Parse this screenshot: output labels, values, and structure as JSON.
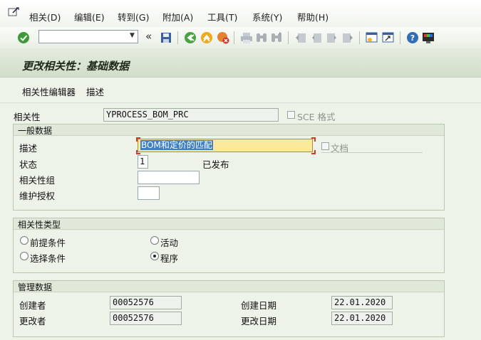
{
  "menu": {
    "items": [
      "相关(D)",
      "编辑(E)",
      "转到(G)",
      "附加(A)",
      "工具(T)",
      "系统(Y)",
      "帮助(H)"
    ]
  },
  "toolbar": {
    "command_field_value": "",
    "icons": [
      "enter-icon",
      "save-icon",
      "back-icon",
      "exit-icon",
      "cancel-icon",
      "print-icon",
      "find-icon",
      "find-next-icon",
      "first-page-icon",
      "previous-page-icon",
      "next-page-icon",
      "last-page-icon",
      "create-session-icon",
      "shortcut-icon",
      "help-icon",
      "layout-icon"
    ]
  },
  "title": "更改相关性：基础数据",
  "app_toolbar": {
    "dependency_editor": "相关性编辑器",
    "description": "描述"
  },
  "header": {
    "dependency_label": "相关性",
    "dependency_value": "YPROCESS_BOM_PRC",
    "sce_format_label": "SCE 格式",
    "sce_format_checked": false
  },
  "general": {
    "title": "一般数据",
    "description_label": "描述",
    "description_value": "BOM和定价的匹配",
    "document_label": "文档",
    "document_checked": false,
    "status_label": "状态",
    "status_value": "1",
    "status_text": "已发布",
    "dependency_group_label": "相关性组",
    "dependency_group_value": "",
    "auth_group_label": "维护授权",
    "auth_group_value": ""
  },
  "dep_type": {
    "title": "相关性类型",
    "options": [
      {
        "label": "前提条件",
        "selected": false
      },
      {
        "label": "活动",
        "selected": false
      },
      {
        "label": "选择条件",
        "selected": false
      },
      {
        "label": "程序",
        "selected": true
      }
    ]
  },
  "admin": {
    "title": "管理数据",
    "created_by_label": "创建者",
    "created_by_value": "00052576",
    "changed_by_label": "更改者",
    "changed_by_value": "00052576",
    "created_on_label": "创建日期",
    "created_on_value": "22.01.2020",
    "changed_on_label": "更改日期",
    "changed_on_value": "22.01.2020"
  }
}
